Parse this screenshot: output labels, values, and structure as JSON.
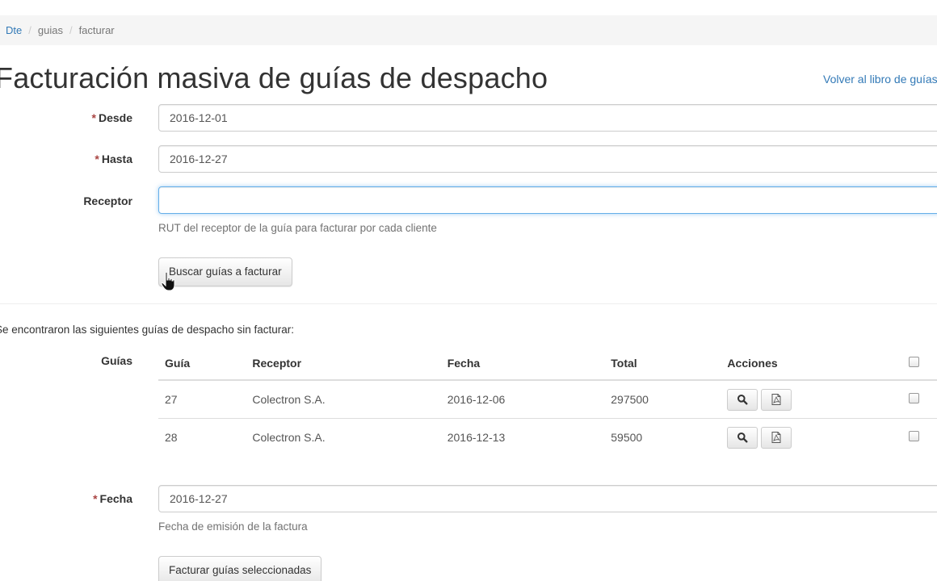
{
  "breadcrumb": {
    "items": [
      "Dte",
      "guias",
      "facturar"
    ]
  },
  "page": {
    "title": "Facturación masiva de guías de despacho",
    "back_link": "Volver al libro de guías"
  },
  "form": {
    "desde": {
      "label": "Desde",
      "value": "2016-12-01"
    },
    "hasta": {
      "label": "Hasta",
      "value": "2016-12-27"
    },
    "receptor": {
      "label": "Receptor",
      "value": "",
      "help": "RUT del receptor de la guía para facturar por cada cliente"
    },
    "search_button": "Buscar guías a facturar"
  },
  "results": {
    "message": "Se encontraron las siguientes guías de despacho sin facturar:",
    "label": "Guías",
    "columns": [
      "Guía",
      "Receptor",
      "Fecha",
      "Total",
      "Acciones"
    ],
    "rows": [
      {
        "guia": "27",
        "receptor": "Colectron S.A.",
        "fecha": "2016-12-06",
        "total": "297500"
      },
      {
        "guia": "28",
        "receptor": "Colectron S.A.",
        "fecha": "2016-12-13",
        "total": "59500"
      }
    ]
  },
  "invoice": {
    "fecha": {
      "label": "Fecha",
      "value": "2016-12-27",
      "help": "Fecha de emisión de la factura"
    },
    "submit_button": "Facturar guías seleccionadas"
  },
  "colors": {
    "link": "#337ab7",
    "required": "#a94442",
    "focus": "#66afe9"
  },
  "icons": [
    "search-icon",
    "pdf-icon",
    "pointer-cursor-icon"
  ]
}
